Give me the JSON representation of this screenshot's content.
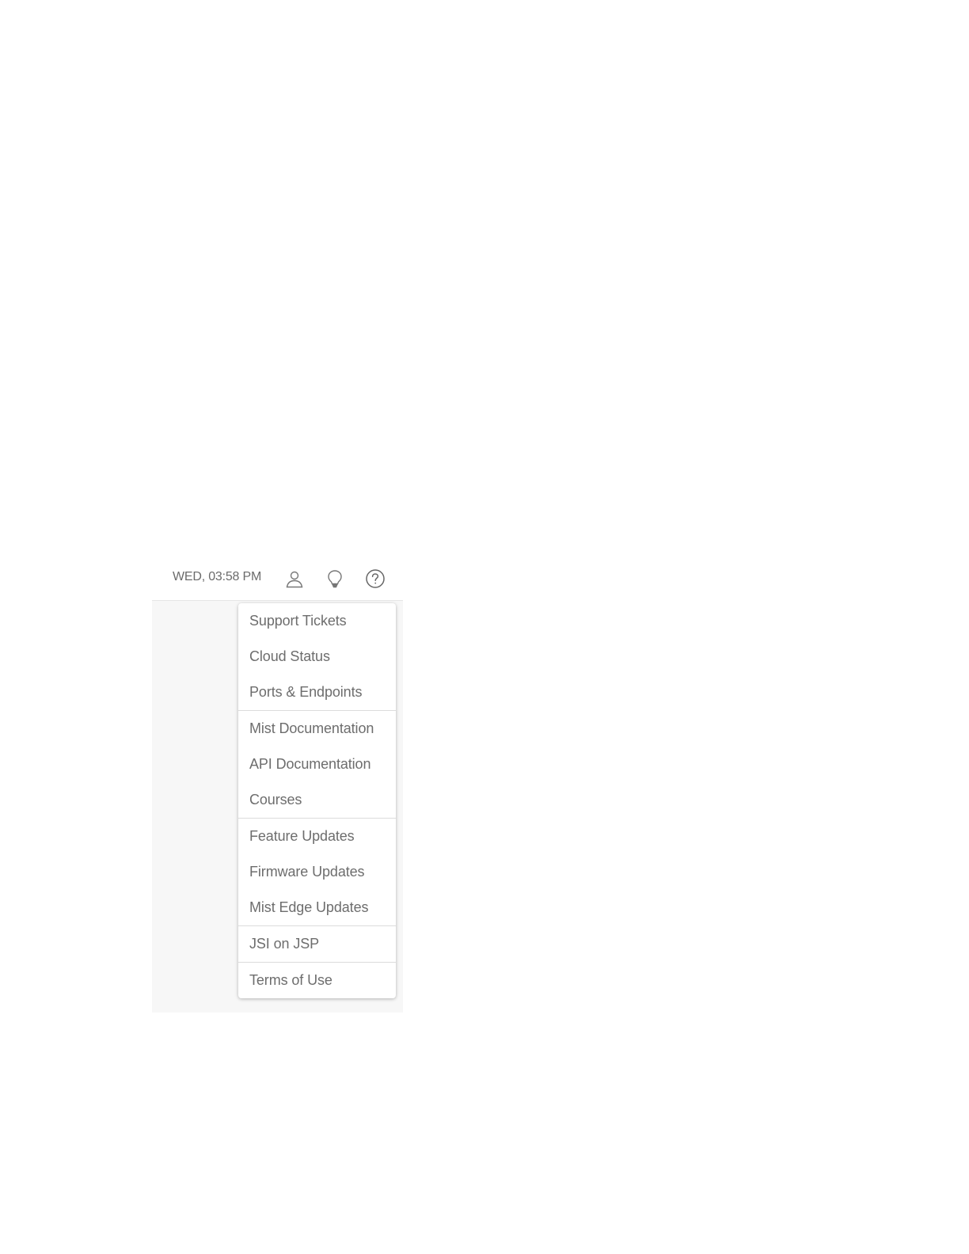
{
  "header": {
    "clock": "WED, 03:58 PM",
    "icons": [
      "user-icon",
      "lightbulb-icon",
      "help-icon"
    ]
  },
  "help_menu": {
    "groups": [
      {
        "items": [
          {
            "label": "Support Tickets"
          },
          {
            "label": "Cloud Status"
          },
          {
            "label": "Ports & Endpoints"
          }
        ]
      },
      {
        "items": [
          {
            "label": "Mist Documentation"
          },
          {
            "label": "API Documentation"
          },
          {
            "label": "Courses"
          }
        ]
      },
      {
        "items": [
          {
            "label": "Feature Updates"
          },
          {
            "label": "Firmware Updates"
          },
          {
            "label": "Mist Edge Updates"
          }
        ]
      },
      {
        "items": [
          {
            "label": "JSI on JSP"
          }
        ]
      },
      {
        "items": [
          {
            "label": "Terms of Use"
          }
        ]
      }
    ]
  },
  "colors": {
    "text": "#6d6d6d",
    "icon": "#777777",
    "menu_bg": "#ffffff",
    "page_bg": "#f7f7f7",
    "divider": "#dcdcdc"
  }
}
